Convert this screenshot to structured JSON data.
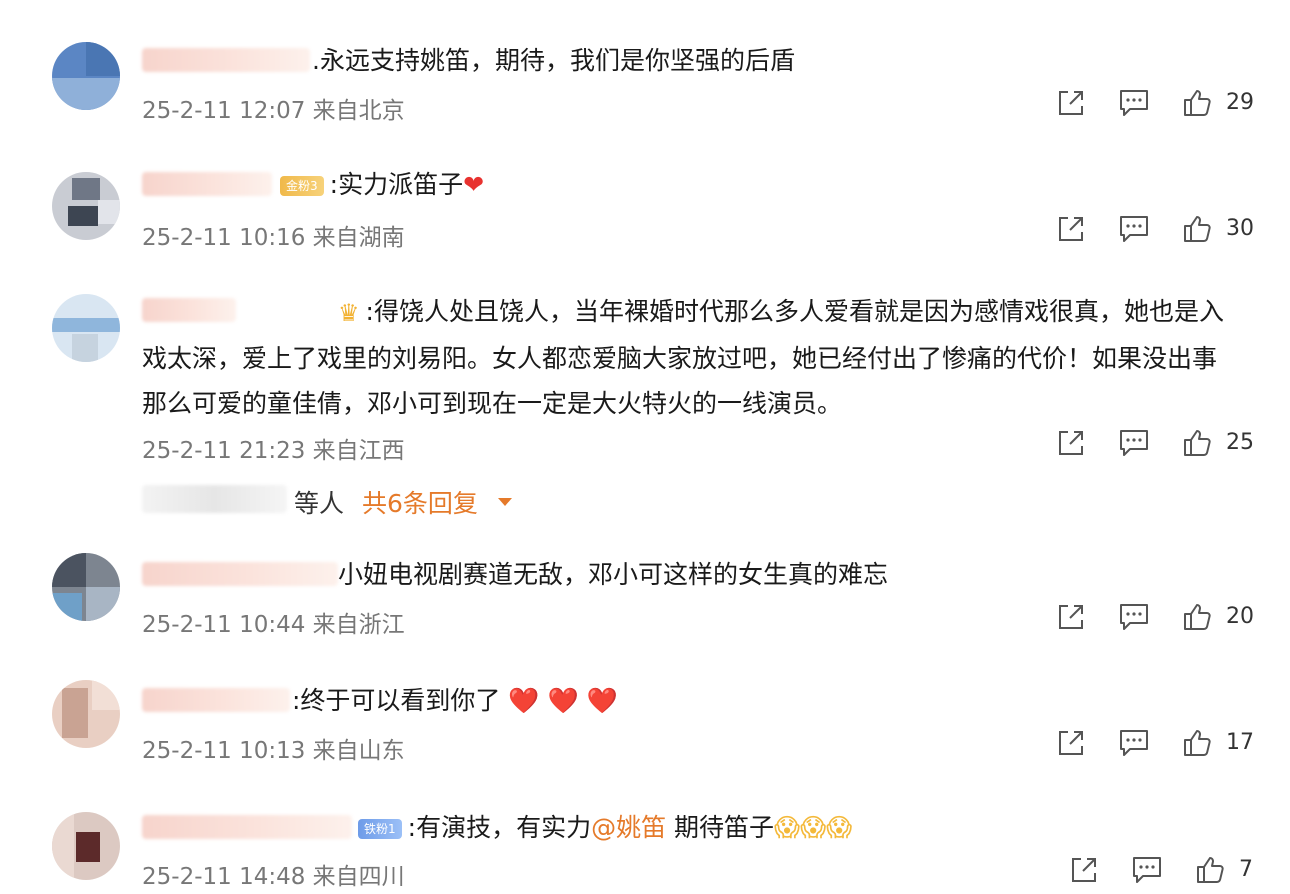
{
  "comments": [
    {
      "text": ".永远支持姚笛，期待，我们是你坚强的后盾",
      "meta": "25-2-11 12:07 来自北京",
      "likes": "29"
    },
    {
      "badge": "金粉3",
      "text": ":实力派笛子",
      "meta": "25-2-11 10:16 来自湖南",
      "likes": "30"
    },
    {
      "text": ":得饶人处且饶人，当年裸婚时代那么多人爱看就是因为感情戏很真，她也是入戏太深，爱上了戏里的刘易阳。女人都恋爱脑大家放过吧，她已经付出了惨痛的代价！如果没出事那么可爱的童佳倩，邓小可到现在一定是大火特火的一线演员。",
      "meta": "25-2-11 21:23 来自江西",
      "likes": "25",
      "replies": {
        "etc": "等人",
        "total": "共6条回复"
      }
    },
    {
      "text": "小妞电视剧赛道无敌，邓小可这样的女生真的难忘",
      "meta": "25-2-11 10:44 来自浙江",
      "likes": "20"
    },
    {
      "text": ":终于可以看到你了",
      "meta": "25-2-11 10:13 来自山东",
      "likes": "17"
    },
    {
      "badge": "铁粉1",
      "text": ":有演技，有实力",
      "mention": "@姚笛",
      "text_after": " 期待笛子",
      "meta": "25-2-11 14:48 来自四川",
      "likes": "7"
    }
  ],
  "icons": {
    "share": "share-icon",
    "comment": "comment-icon",
    "like": "thumbs-up-icon"
  },
  "colors": {
    "accent": "#e57a2a",
    "meta": "#777777"
  }
}
